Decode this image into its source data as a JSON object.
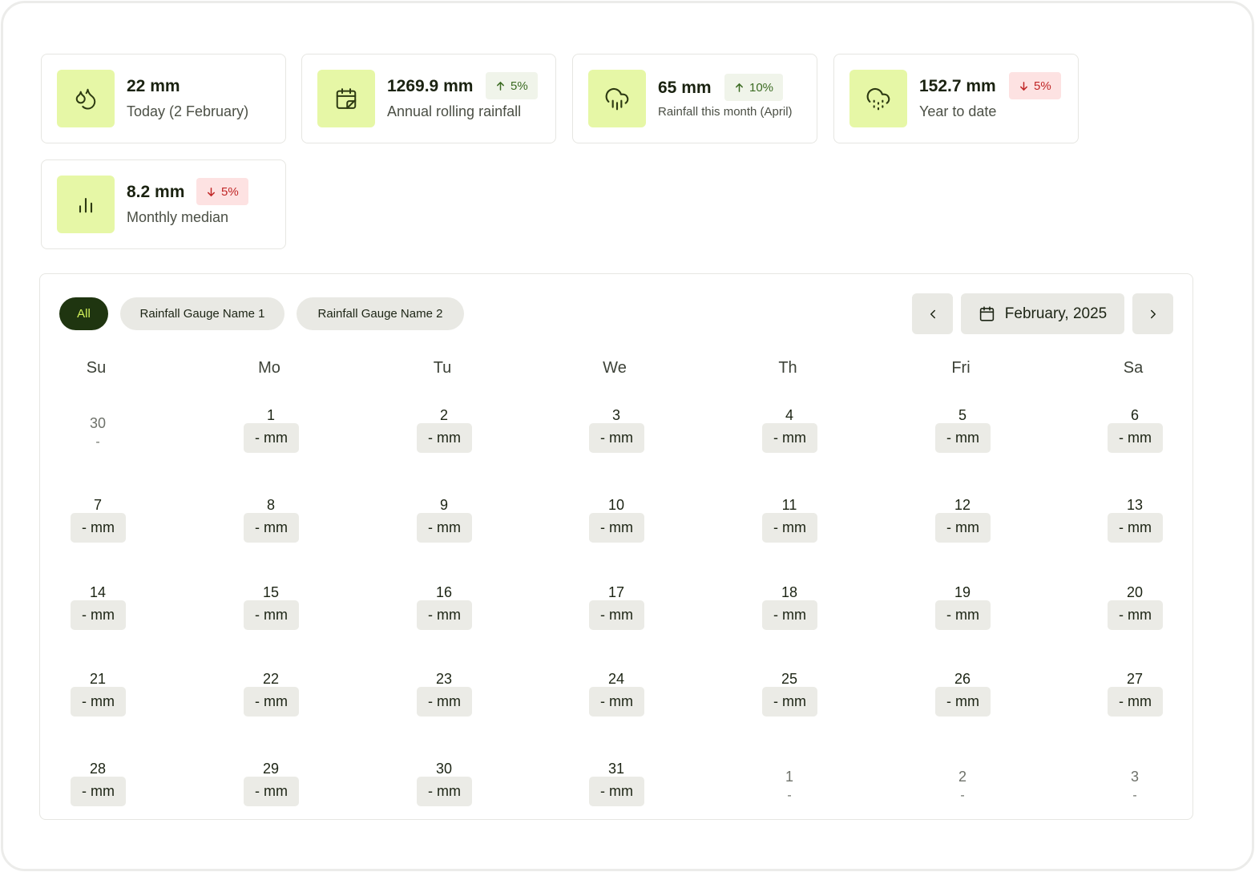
{
  "stats": [
    {
      "icon": "droplets-icon",
      "value": "22  mm",
      "label": "Today (2 February)",
      "badge": null
    },
    {
      "icon": "calendar-note-icon",
      "value": "1269.9 mm",
      "label": "Annual rolling rainfall",
      "badge": {
        "dir": "up",
        "text": "5%"
      }
    },
    {
      "icon": "cloud-rain-icon",
      "value": "65  mm",
      "label": "Rainfall this month (April)",
      "badge": {
        "dir": "up",
        "text": "10%"
      }
    },
    {
      "icon": "cloud-drizzle-icon",
      "value": "152.7  mm",
      "label": "Year to date",
      "badge": {
        "dir": "down",
        "text": "5%"
      }
    },
    {
      "icon": "bar-chart-icon",
      "value": "8.2 mm",
      "label": "Monthly median",
      "badge": {
        "dir": "down",
        "text": "5%"
      }
    }
  ],
  "filters": [
    "All",
    "Rainfall Gauge Name 1",
    "Rainfall Gauge Name 2"
  ],
  "active_filter": "All",
  "month_label": "February, 2025",
  "weekdays": [
    "Su",
    "Mo",
    "Tu",
    "We",
    "Th",
    "Fri",
    "Sa"
  ],
  "weeks": [
    [
      {
        "d": "30",
        "other": true,
        "v": "-"
      },
      {
        "d": "1",
        "v": "- mm"
      },
      {
        "d": "2",
        "v": "- mm"
      },
      {
        "d": "3",
        "v": "- mm"
      },
      {
        "d": "4",
        "v": "- mm"
      },
      {
        "d": "5",
        "v": "- mm"
      },
      {
        "d": "6",
        "v": "- mm"
      }
    ],
    [
      {
        "d": "7",
        "v": "- mm"
      },
      {
        "d": "8",
        "v": "- mm"
      },
      {
        "d": "9",
        "v": "- mm"
      },
      {
        "d": "10",
        "v": "- mm"
      },
      {
        "d": "11",
        "v": "- mm"
      },
      {
        "d": "12",
        "v": "- mm"
      },
      {
        "d": "13",
        "v": "- mm"
      }
    ],
    [
      {
        "d": "14",
        "v": "- mm"
      },
      {
        "d": "15",
        "v": "- mm"
      },
      {
        "d": "16",
        "v": "- mm"
      },
      {
        "d": "17",
        "v": "- mm"
      },
      {
        "d": "18",
        "v": "- mm"
      },
      {
        "d": "19",
        "v": "- mm"
      },
      {
        "d": "20",
        "v": "- mm"
      }
    ],
    [
      {
        "d": "21",
        "v": "- mm"
      },
      {
        "d": "22",
        "v": "- mm"
      },
      {
        "d": "23",
        "v": "- mm"
      },
      {
        "d": "24",
        "v": "- mm"
      },
      {
        "d": "25",
        "v": "- mm"
      },
      {
        "d": "26",
        "v": "- mm"
      },
      {
        "d": "27",
        "v": "- mm"
      }
    ],
    [
      {
        "d": "28",
        "v": "- mm"
      },
      {
        "d": "29",
        "v": "- mm"
      },
      {
        "d": "30",
        "v": "- mm"
      },
      {
        "d": "31",
        "v": "- mm"
      },
      {
        "d": "1",
        "other": true,
        "v": "-"
      },
      {
        "d": "2",
        "other": true,
        "v": "-"
      },
      {
        "d": "3",
        "other": true,
        "v": "-"
      }
    ]
  ],
  "colors": {
    "accent_bg": "#e6f7a6",
    "active_chip": "#1f3510",
    "active_chip_text": "#d4f45c",
    "up": "#3b6b22",
    "down": "#c02626"
  }
}
